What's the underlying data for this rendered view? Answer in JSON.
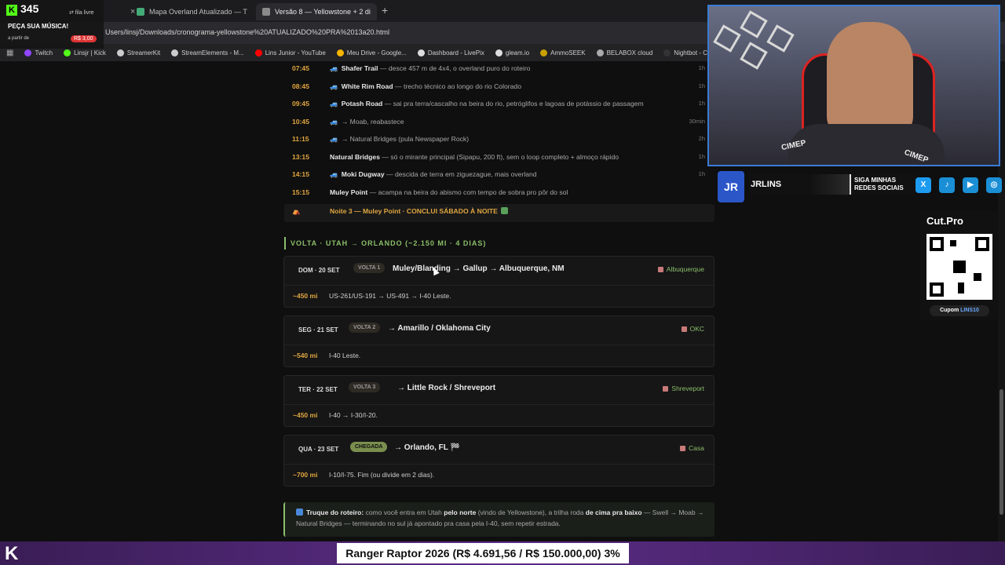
{
  "browser": {
    "tabs": [
      {
        "label": "Mapa Overland Atualizado — T"
      },
      {
        "label": "Versão 8 — Yellowstone + 2 di"
      }
    ],
    "tab_close": "×",
    "new_tab": "+",
    "url": "Users/linsj/Downloads/cronograma-yellowstone%20ATUALIZADO%20PRA%2013a20.html",
    "bookmarks": [
      {
        "label": "Twitch",
        "color": "#9146ff"
      },
      {
        "label": "Linsjr | Kick",
        "color": "#53fc18"
      },
      {
        "label": "StreamerKit",
        "color": "#cccccc"
      },
      {
        "label": "StreamElements - M...",
        "color": "#cccccc"
      },
      {
        "label": "Lins Junior - YouTube",
        "color": "#ff0000"
      },
      {
        "label": "Meu Drive - Google...",
        "color": "#f4b400"
      },
      {
        "label": "Dashboard - LivePix",
        "color": "#dddddd"
      },
      {
        "label": "gleam.io",
        "color": "#dddddd"
      },
      {
        "label": "AmmoSEEK",
        "color": "#c9a000"
      },
      {
        "label": "BELABOX cloud",
        "color": "#aaaaaa"
      },
      {
        "label": "Nightbot - Comm",
        "color": "#333333"
      }
    ]
  },
  "kick_widget": {
    "logo": "K",
    "count": "345",
    "fila": "⇄ fila livre",
    "title": "PEÇA SUA MÚSICA!",
    "from": "a partir de",
    "price": "R$ 3,00"
  },
  "schedule": [
    {
      "time": "07:45",
      "car": true,
      "place": "Shafer Trail",
      "desc": " — desce 457 m de 4x4, o overland puro do roteiro",
      "dur": "1h"
    },
    {
      "time": "08:45",
      "car": true,
      "place": "White Rim Road",
      "desc": " — trecho técnico ao longo do rio Colorado",
      "dur": "1h"
    },
    {
      "time": "09:45",
      "car": true,
      "place": "Potash Road",
      "desc": " — sai pra terra/cascalho na beira do rio, petróglifos e lagoas de potássio de passagem",
      "dur": "1h"
    },
    {
      "time": "10:45",
      "car": true,
      "place": "",
      "desc": "→ Moab, reabastece",
      "dur": "30min"
    },
    {
      "time": "11:15",
      "car": true,
      "place": "",
      "desc": "→ Natural Bridges (pula Newspaper Rock)",
      "dur": "2h"
    },
    {
      "time": "13:15",
      "car": false,
      "place": "Natural Bridges",
      "desc": " — só o mirante principal (Sipapu, 200 ft), sem o loop completo + almoço rápido",
      "dur": "1h"
    },
    {
      "time": "14:15",
      "car": true,
      "place": "Moki Dugway",
      "desc": " — descida de terra em ziguezague, mais overland",
      "dur": "1h"
    },
    {
      "time": "15:15",
      "car": false,
      "place": "Muley Point",
      "desc": " — acampa na beira do abismo com tempo de sobra pro pôr do sol",
      "dur": ""
    }
  ],
  "night": {
    "icon": "⛺",
    "text": "Noite 3 — Muley Point · CONCLUI SÁBADO À NOITE"
  },
  "section_title": "VOLTA · UTAH → ORLANDO (~2.150 MI · 4 DIAS)",
  "cards": [
    {
      "day": "DOM · 20 SET",
      "badge": "VOLTA 1",
      "route": "Muley/Blanding → Gallup → Albuquerque, NM",
      "dest": "Albuquerque",
      "mi": "~450 mi",
      "roads": "US-261/US-191 → US-491 → I-40 Leste.",
      "arrive": false
    },
    {
      "day": "SEG · 21 SET",
      "badge": "VOLTA 2",
      "route": "→ Amarillo / Oklahoma City",
      "dest": "OKC",
      "mi": "~540 mi",
      "roads": "I-40 Leste.",
      "arrive": false
    },
    {
      "day": "TER · 22 SET",
      "badge": "VOLTA 3",
      "route": "→ Little Rock / Shreveport",
      "dest": "Shreveport",
      "mi": "~450 mi",
      "roads": "I-40 → I-30/I-20.",
      "arrive": false
    },
    {
      "day": "QUA · 23 SET",
      "badge": "CHEGADA",
      "route": "→ Orlando, FL 🏁",
      "dest": "Casa",
      "mi": "~700 mi",
      "roads": "I-10/I-75. Fim (ou divide em 2 dias).",
      "arrive": true
    }
  ],
  "tip": {
    "label": "Truque do roteiro:",
    "p1": " como você entra em Utah ",
    "b1": "pelo norte",
    "p2": " (vindo de Yellowstone), a trilha roda ",
    "b2": "de cima pra baixo",
    "p3": " — Swell → Moab → Natural Bridges — terminando no sul já apontado pra casa pela I-40, sem repetir estrada."
  },
  "social": {
    "logo": "JR",
    "name": "JRLINS",
    "follow": "SIGA MINHAS REDES SOCIAIS",
    "icons": [
      {
        "name": "x",
        "glyph": "X",
        "color": "#1d9bf0"
      },
      {
        "name": "tiktok",
        "glyph": "♪",
        "color": "#1b8fd6"
      },
      {
        "name": "youtube",
        "glyph": "▶",
        "color": "#1b8fd6"
      },
      {
        "name": "instagram",
        "glyph": "◎",
        "color": "#1b8fd6"
      }
    ]
  },
  "cam": {
    "chair_text": "CIMEP"
  },
  "cutpro": {
    "title": "Cut.Pro",
    "coupon_label": "Cupom",
    "coupon_code": "LINS10"
  },
  "ticker": {
    "text": "Ranger Raptor 2026 (R$ 4.691,56 / R$ 150.000,00)  3%",
    "progress": 0.03
  },
  "bottom_logo": "K"
}
